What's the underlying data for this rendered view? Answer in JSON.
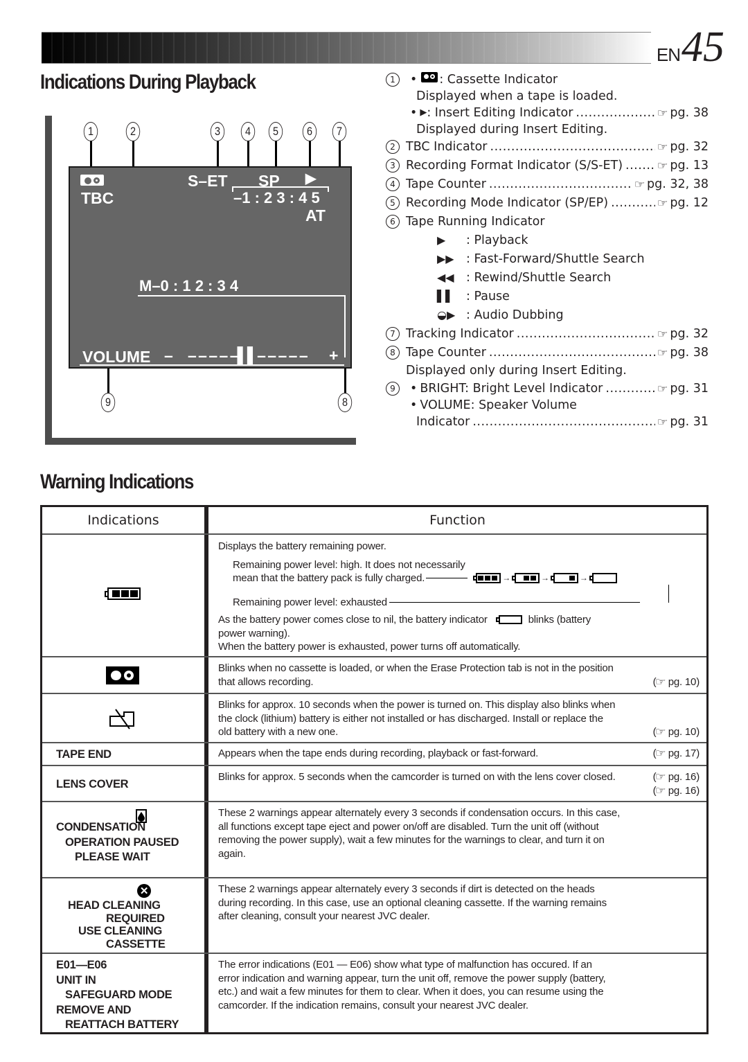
{
  "header": {
    "lang_prefix": "EN",
    "page_number": "45"
  },
  "playback": {
    "title": "Indications During Playback",
    "callouts": [
      "1",
      "2",
      "3",
      "4",
      "5",
      "6",
      "7",
      "8",
      "9"
    ],
    "screen": {
      "tbc": "TBC",
      "format": "S–ET",
      "mode": "SP",
      "running": "▶",
      "counter": "–1 : 2 3 : 4 5",
      "tracking": "AT",
      "memory_counter": "M–0 : 1 2 : 3 4",
      "volume_label": "VOLUME",
      "volume_minus": "–",
      "volume_bar": "– – – – –▌▌– – – – –",
      "volume_plus": "+"
    },
    "items": [
      {
        "num": "1",
        "bullet": "•",
        "icon": "cassette-icon",
        "label": ": Cassette Indicator"
      },
      {
        "text": "Displayed when a tape is loaded."
      },
      {
        "bullet": "•",
        "icon": "insert-edit-icon",
        "icon_glyph": "▶",
        "label": ": Insert Editing Indicator",
        "ref": "pg. 38"
      },
      {
        "text": "Displayed during Insert Editing."
      },
      {
        "num": "2",
        "label": "TBC Indicator",
        "ref": "pg. 32"
      },
      {
        "num": "3",
        "label": "Recording Format Indicator (S/S-ET)",
        "ref": "pg. 13"
      },
      {
        "num": "4",
        "label": "Tape Counter",
        "ref": "pg. 32, 38"
      },
      {
        "num": "5",
        "label": "Recording Mode Indicator (SP/EP)",
        "ref": "pg. 12"
      },
      {
        "num": "6",
        "label": "Tape Running Indicator"
      },
      {
        "symbol": "▶",
        "label": ": Playback"
      },
      {
        "symbol": "▶▶",
        "label": ": Fast-Forward/Shuttle Search"
      },
      {
        "symbol": "◀◀",
        "label": ": Rewind/Shuttle Search"
      },
      {
        "symbol": "▌▌",
        "label": ": Pause"
      },
      {
        "symbol": "◒▶",
        "label": ": Audio Dubbing"
      },
      {
        "num": "7",
        "label": "Tracking Indicator",
        "ref": "pg. 32"
      },
      {
        "num": "8",
        "label": "Tape Counter",
        "ref": "pg. 38"
      },
      {
        "text": "Displayed only during Insert Editing."
      },
      {
        "num": "9",
        "bullet": "•",
        "label": "BRIGHT: Bright Level Indicator",
        "ref": "pg. 31"
      },
      {
        "bullet": "•",
        "label": "VOLUME: Speaker Volume"
      },
      {
        "label": "Indicator",
        "ref": "pg. 31"
      }
    ],
    "ref_icon": "☞"
  },
  "warnings": {
    "title": "Warning Indications",
    "columns": [
      "Indications",
      "Function"
    ],
    "rows": [
      {
        "indication_icon": "battery-icon",
        "indication_lines": [],
        "function": {
          "intro": "Displays the battery remaining power.",
          "high_1": "Remaining power level: high. It does not necessarily",
          "high_2": "mean that the battery pack is fully charged.",
          "exhausted": "Remaining power level: exhausted",
          "blink_1a": "As the battery power comes close to nil, the battery indicator",
          "blink_1b": "blinks (battery",
          "blink_2": "power warning).",
          "off": "When the battery power is exhausted, power turns off automatically."
        },
        "battery_levels": [
          3,
          2,
          1,
          0
        ]
      },
      {
        "indication_icon": "cassette-icon",
        "function_lines": [
          "Blinks when no cassette is loaded, or when the Erase Protection tab is not in the position",
          "that allows recording."
        ],
        "ref": "pg. 10"
      },
      {
        "indication_icon": "clock-battery-icon",
        "function_lines": [
          "Blinks for approx. 10 seconds when the power is turned on. This display also blinks when",
          "the clock (lithium) battery is either not installed or has discharged. Install or replace the",
          "old battery with a new one."
        ],
        "ref": "pg. 10"
      },
      {
        "indication_lines": [
          "TAPE END"
        ],
        "function_lines": [
          "Appears when the tape ends during recording, playback or fast-forward."
        ],
        "ref": "pg. 17"
      },
      {
        "indication_lines": [
          "LENS COVER"
        ],
        "function_lines": [
          "Blinks for approx. 5 seconds when the camcorder is turned on with the lens cover closed."
        ],
        "ref": "pg. 16"
      },
      {
        "indication_icon": "condensation-icon",
        "indication_lines": [
          "CONDENSATION",
          "OPERATION PAUSED",
          "PLEASE WAIT"
        ],
        "function_lines": [
          "These 2 warnings appear alternately every 3 seconds if condensation occurs. In this case,",
          "all functions except tape eject and power on/off are disabled. Turn the unit off (without",
          "removing the power supply), wait a few minutes for the warnings to clear, and turn it on",
          "again."
        ]
      },
      {
        "indication_icon": "head-cleaning-icon",
        "indication_lines": [
          "HEAD CLEANING",
          "REQUIRED",
          "USE CLEANING",
          "CASSETTE"
        ],
        "function_lines": [
          "These 2 warnings appear alternately every 3 seconds if dirt is detected on the heads",
          "during recording. In this case, use an optional cleaning cassette. If the warning remains",
          "after cleaning, consult your nearest JVC dealer."
        ]
      },
      {
        "indication_lines": [
          "E01—E06",
          "UNIT IN",
          "SAFEGUARD MODE",
          "REMOVE AND",
          "REATTACH BATTERY"
        ],
        "function_lines": [
          "The error indications (E01 — E06) show what type of malfunction has occured. If an",
          "error indication and warning appear, turn the unit off, remove the power supply (battery,",
          "etc.) and wait a few minutes for them to clear. When it does, you can resume using the",
          "camcorder. If the indication remains, consult your nearest JVC dealer."
        ]
      }
    ]
  }
}
